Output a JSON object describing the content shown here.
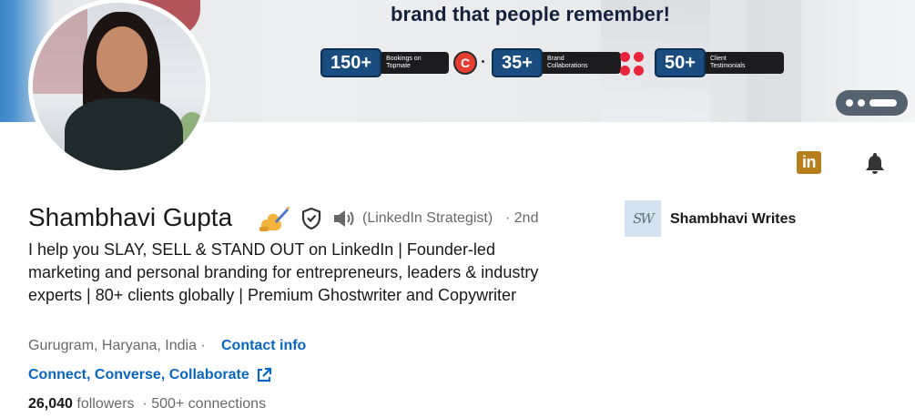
{
  "banner": {
    "headline": "brand that people remember!",
    "stats": [
      {
        "number": "150+",
        "label_line1": "Bookings on",
        "label_line2": "Topmate"
      },
      {
        "number": "35+",
        "label_line1": "Brand",
        "label_line2": "Collaborations"
      },
      {
        "number": "50+",
        "label_line1": "Client",
        "label_line2": "Testimonials"
      }
    ],
    "topmate_logo_letter": "C"
  },
  "profile": {
    "name": "Shambhavi Gupta",
    "emoji": "writing-hand-emoji",
    "pronouns": "(LinkedIn Strategist)",
    "degree": "· 2nd",
    "headline": "I help you SLAY, SELL & STAND OUT on LinkedIn | Founder-led marketing and personal branding for entrepreneurs, leaders & industry experts | 80+ clients globally | Premium Ghostwriter and Copywriter",
    "location": "Gurugram, Haryana, India ·",
    "contact_info": "Contact info",
    "website": "Connect, Converse, Collaborate",
    "followers_count": "26,040",
    "followers_label": "followers",
    "connections": "· 500+ connections"
  },
  "company": {
    "name": "Shambhavi Writes",
    "logo_text": "SW"
  },
  "icons": {
    "linkedin": "in",
    "linkedin_color": "#b77e1c",
    "link_color": "#0a66c2"
  }
}
